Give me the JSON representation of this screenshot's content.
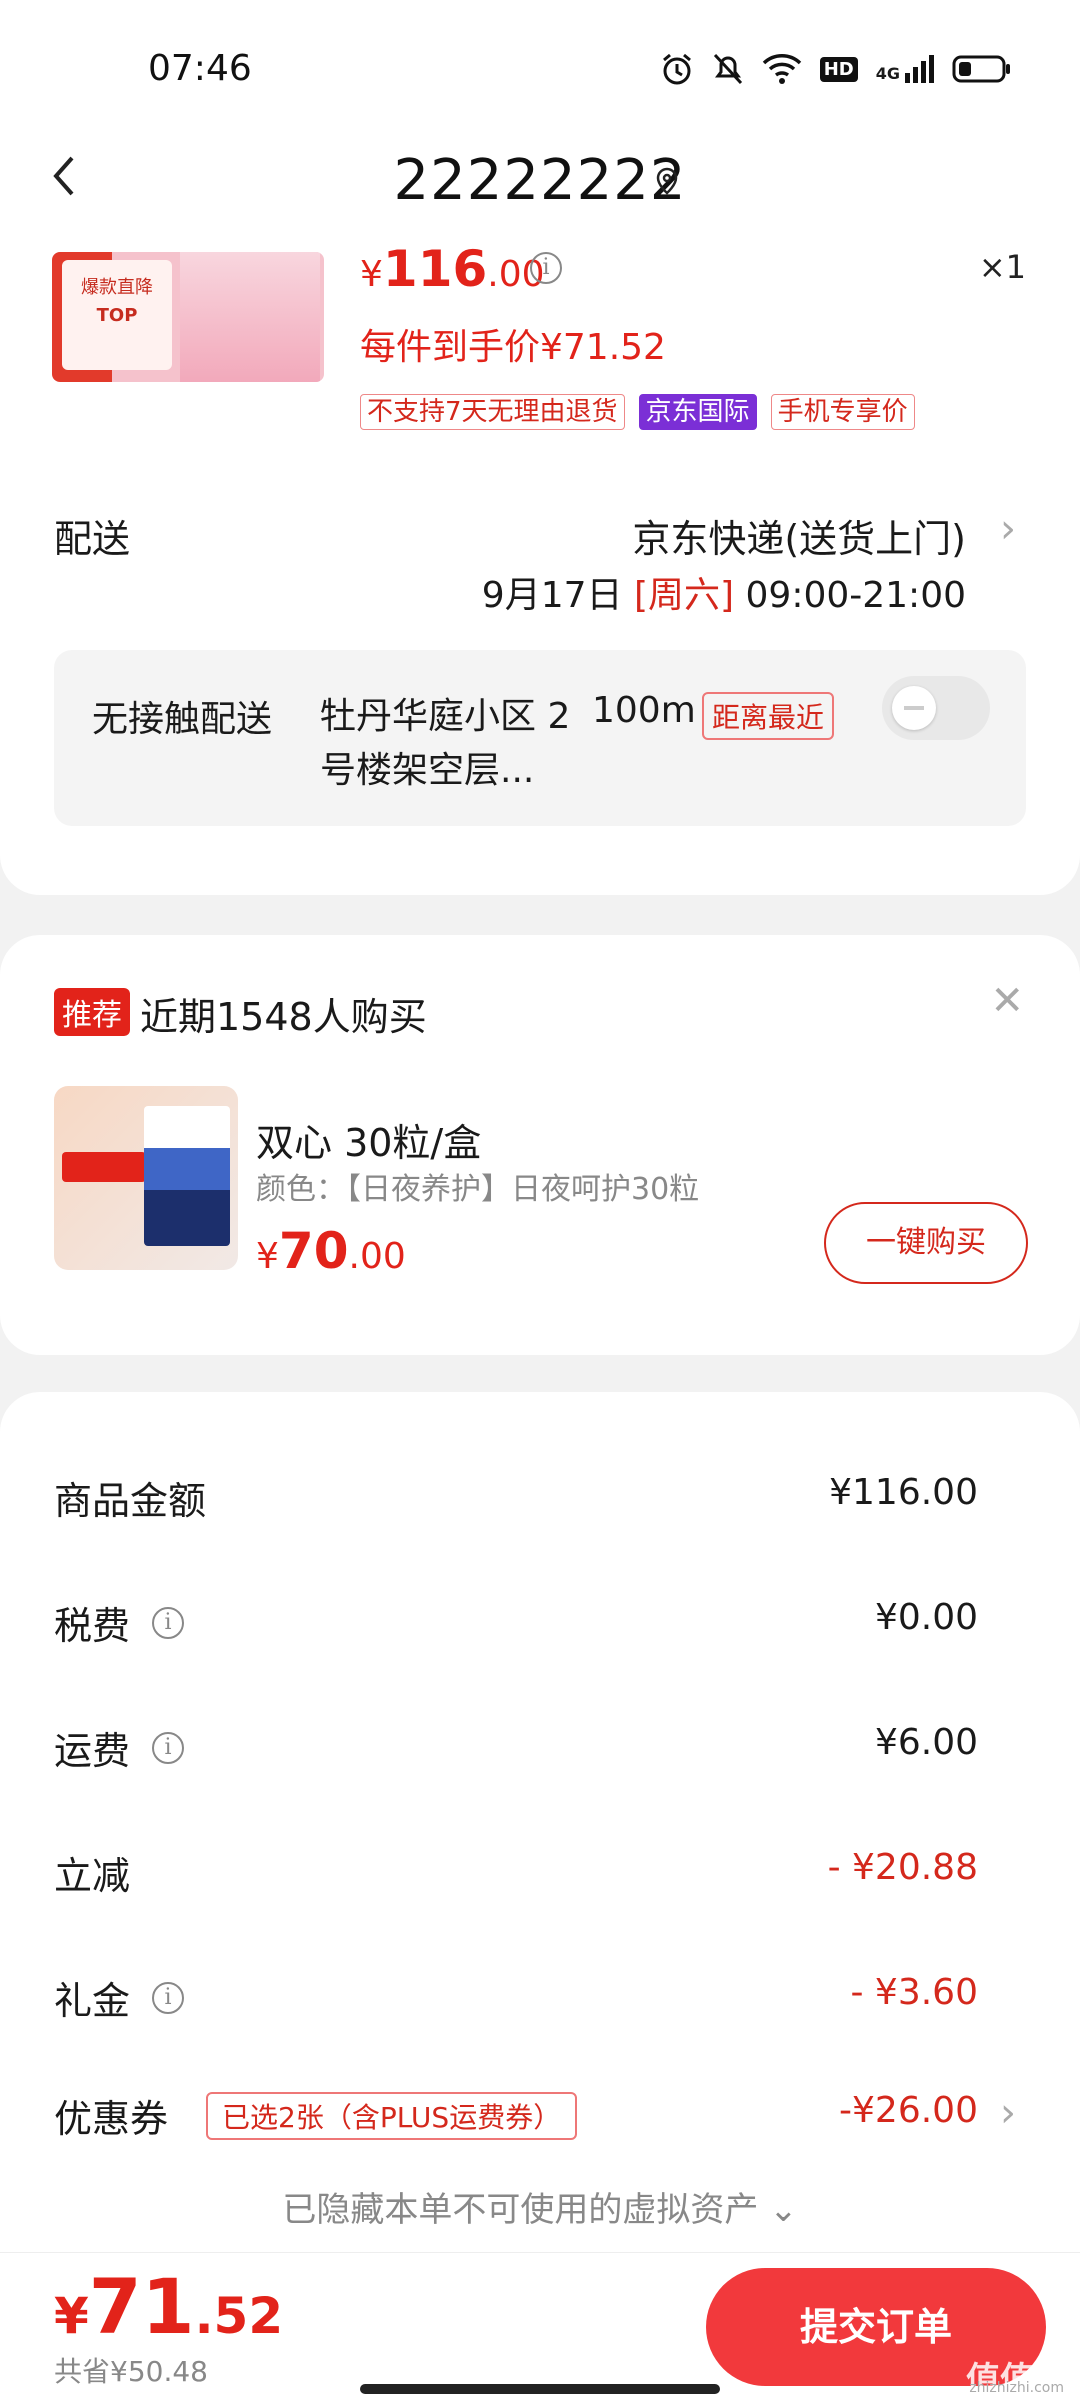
{
  "status_bar": {
    "time": "07:46",
    "icons": [
      "alarm-icon",
      "mute-icon",
      "wifi-icon",
      "hd-icon",
      "4g-signal-icon",
      "battery-icon"
    ],
    "hd_label": "HD",
    "network_label": "4G"
  },
  "header": {
    "title": "22222222"
  },
  "product": {
    "image_badge_top": "爆款直降",
    "image_badge_mid": "TOP",
    "price_yen": "¥",
    "price_int": "116",
    "price_dec": ".00",
    "quantity": "×1",
    "per_item_price": "每件到手价¥71.52",
    "tags": [
      "不支持7天无理由退货",
      "京东国际",
      "手机专享价"
    ]
  },
  "shipping": {
    "label": "配送",
    "method": "京东快递(送货上门)",
    "date": "9月17日",
    "weekday": "[周六]",
    "time_window": "09:00-21:00",
    "contactless_label": "无接触配送",
    "address": "牡丹华庭小区 2号楼架空层...",
    "distance": "100m",
    "distance_tag": "距离最近",
    "contactless_enabled": false
  },
  "recommend": {
    "badge": "推荐",
    "title": "近期1548人购买",
    "product_name": "双心 30粒/盒",
    "product_color": "颜色：【日夜养护】日夜呵护30粒",
    "price_yen": "¥",
    "price_int": "70",
    "price_dec": ".00",
    "buy_label": "一键购买"
  },
  "summary": {
    "rows": [
      {
        "label": "商品金额",
        "value": "¥116.00",
        "info": false,
        "negative": false
      },
      {
        "label": "税费",
        "value": "¥0.00",
        "info": true,
        "negative": false
      },
      {
        "label": "运费",
        "value": "¥6.00",
        "info": true,
        "negative": false
      },
      {
        "label": "立减",
        "value": "- ¥20.88",
        "info": false,
        "negative": true
      },
      {
        "label": "礼金",
        "value": "- ¥3.60",
        "info": true,
        "negative": true
      }
    ],
    "coupon_label": "优惠券",
    "coupon_tag": "已选2张（含PLUS运费券）",
    "coupon_value": "-¥26.00",
    "hidden_assets": "已隐藏本单不可使用的虚拟资产 ⌄"
  },
  "footer": {
    "total_yen": "¥",
    "total_int": "71",
    "total_dec": ".52",
    "saved": "共省¥50.48",
    "submit_label": "提交订单",
    "watermark": "值值值",
    "watermark_sub": "zhizhizhi.com"
  },
  "colors": {
    "accent_red": "#e2231a",
    "submit_red": "#f2393c",
    "tag_purple": "#7b2fd6"
  }
}
